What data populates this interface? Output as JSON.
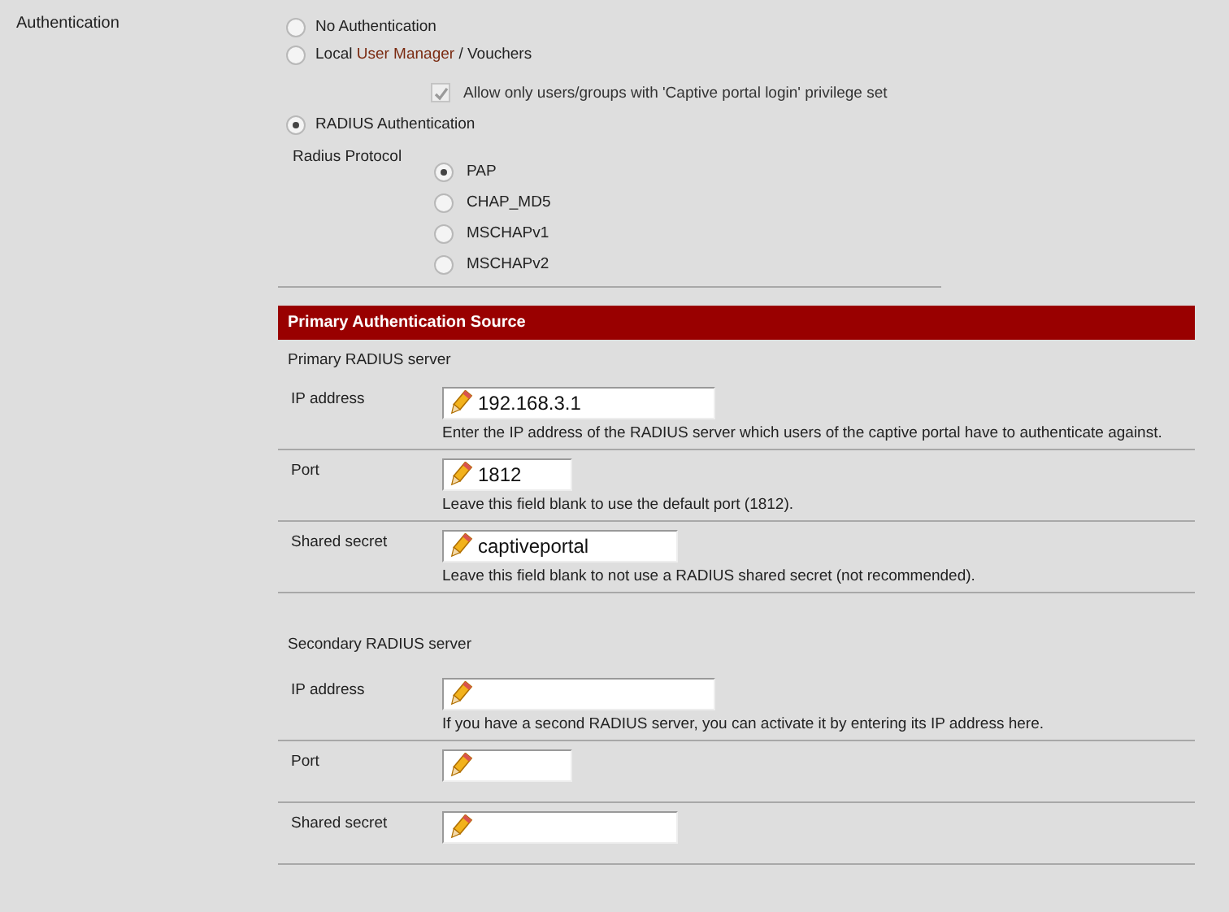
{
  "authentication": {
    "label": "Authentication",
    "options": [
      {
        "label_parts": [
          "No Authentication"
        ],
        "selected": false
      },
      {
        "label_parts": [
          "Local ",
          "User Manager",
          " / Vouchers"
        ],
        "selected": false
      },
      {
        "label_parts": [
          "RADIUS Authentication"
        ],
        "selected": true
      }
    ],
    "privilege_checkbox": {
      "label": "Allow only users/groups with 'Captive portal login' privilege set",
      "checked": true,
      "disabled": true
    },
    "radius_protocol": {
      "label": "Radius Protocol",
      "options": [
        {
          "label": "PAP",
          "selected": true
        },
        {
          "label": "CHAP_MD5",
          "selected": false
        },
        {
          "label": "MSCHAPv1",
          "selected": false
        },
        {
          "label": "MSCHAPv2",
          "selected": false
        }
      ]
    }
  },
  "section": {
    "title": "Primary Authentication Source",
    "groups": [
      {
        "title": "Primary RADIUS server",
        "fields": [
          {
            "label": "IP address",
            "value": "192.168.3.1",
            "help": "Enter the IP address of the RADIUS server which users of the captive portal have to authenticate against."
          },
          {
            "label": "Port",
            "value": "1812",
            "help": "Leave this field blank to use the default port (1812)."
          },
          {
            "label": "Shared secret",
            "value": "captiveportal",
            "help": "Leave this field blank to not use a RADIUS shared secret (not recommended)."
          }
        ]
      },
      {
        "title": "Secondary RADIUS server",
        "fields": [
          {
            "label": "IP address",
            "help": "If you have a second RADIUS server, you can activate it by entering its IP address here."
          },
          {
            "label": "Port"
          },
          {
            "label": "Shared secret"
          }
        ]
      }
    ]
  }
}
